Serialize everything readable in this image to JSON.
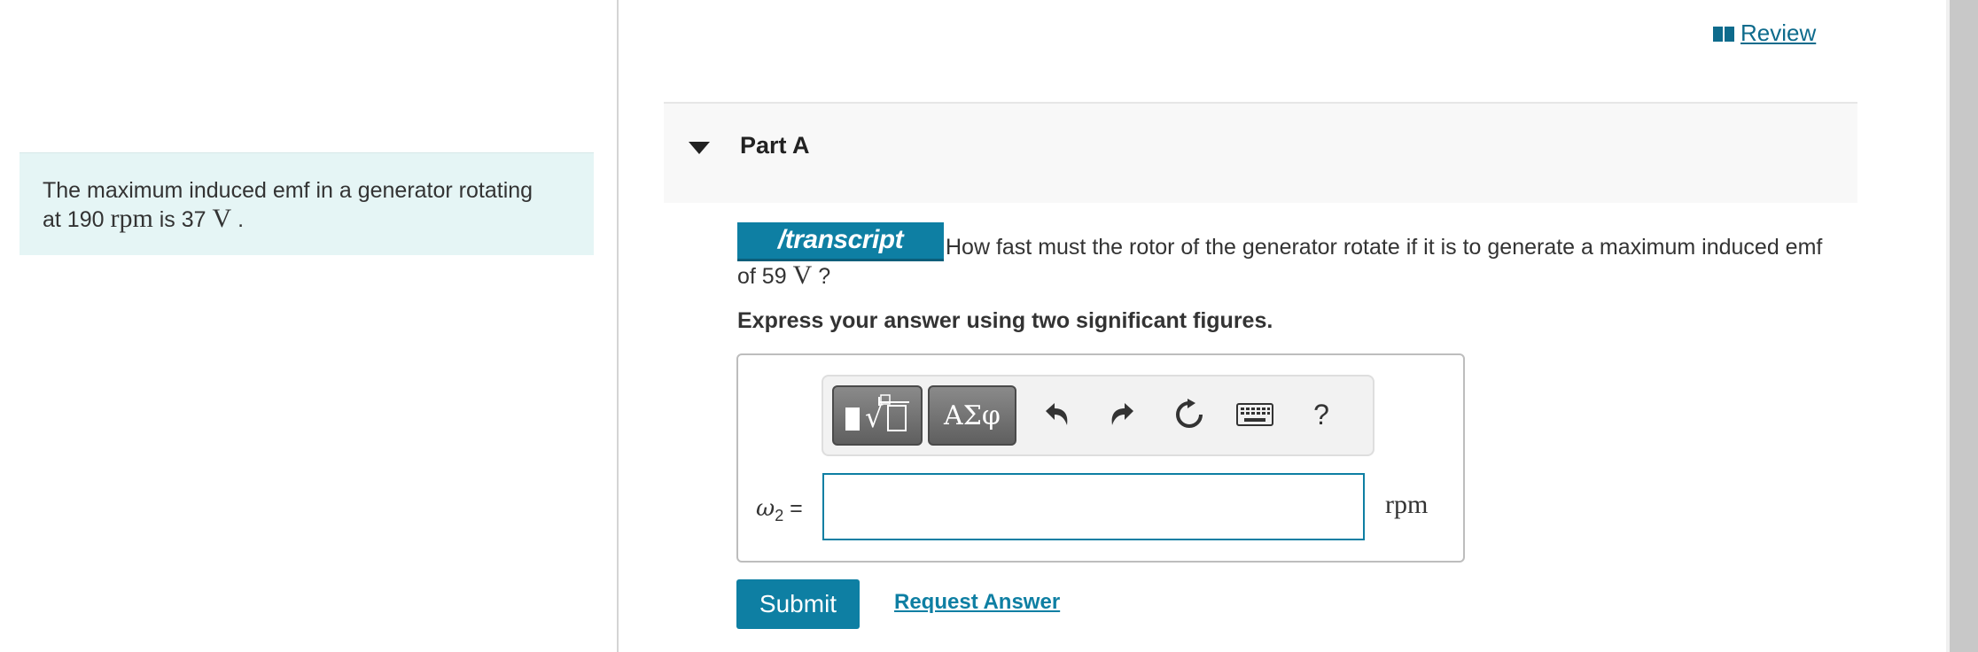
{
  "problem": {
    "intro_pre": "The maximum induced emf in a generator rotating",
    "intro_at": "at 190",
    "intro_rpm": "rpm",
    "intro_is": "is 37",
    "intro_v": "V",
    "intro_end": "."
  },
  "header": {
    "review_label": " Review"
  },
  "part": {
    "title": "Part A"
  },
  "question": {
    "logo_text": "/transcript",
    "text_line1": "How fast must the rotor of the generator rotate if it is to generate a maximum induced emf",
    "text_line2_pre": "of 59",
    "text_line2_v": "V",
    "text_line2_end": "?",
    "instruction": "Express your answer using two significant figures."
  },
  "toolbar": {
    "symbols_label": "ΑΣφ",
    "help_label": "?"
  },
  "answer": {
    "variable": "ω",
    "subscript": "2",
    "equals": "=",
    "value": "",
    "unit": "rpm"
  },
  "actions": {
    "submit_label": "Submit",
    "request_label": "Request Answer"
  },
  "colors": {
    "accent": "#0e7fa3",
    "info_panel": "#e5f5f5",
    "link": "#0e6b8c"
  }
}
